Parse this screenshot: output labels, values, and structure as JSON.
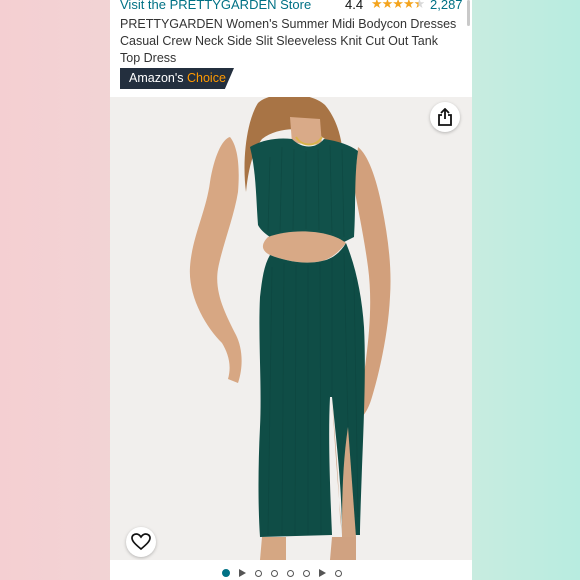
{
  "header": {
    "store_link": "Visit the PRETTYGARDEN Store",
    "rating": "4.4",
    "stars": "★★★★",
    "half_star": "★",
    "rating_count": "2,287"
  },
  "product": {
    "title": "PRETTYGARDEN Women's Summer Midi Bodycon Dresses Casual Crew Neck Side Slit Sleeveless Knit Cut Out Tank Top Dress",
    "badge_prefix": "Amazon's",
    "badge_suffix": "Choice",
    "image_subject": "green ribbed knit sleeveless cut-out midi dress",
    "rating_value": 4.4,
    "rating_max": 5
  },
  "carousel": {
    "items": [
      "dot-active",
      "play",
      "dot",
      "dot",
      "dot",
      "dot",
      "play",
      "dot"
    ],
    "active_index": 0
  },
  "colors": {
    "link": "#007185",
    "star": "#f4a41d",
    "badge_bg": "#232f3e",
    "badge_accent": "#ff9900",
    "dress": "#11514a"
  },
  "icons": {
    "share": "share-icon",
    "wishlist": "heart-icon"
  }
}
